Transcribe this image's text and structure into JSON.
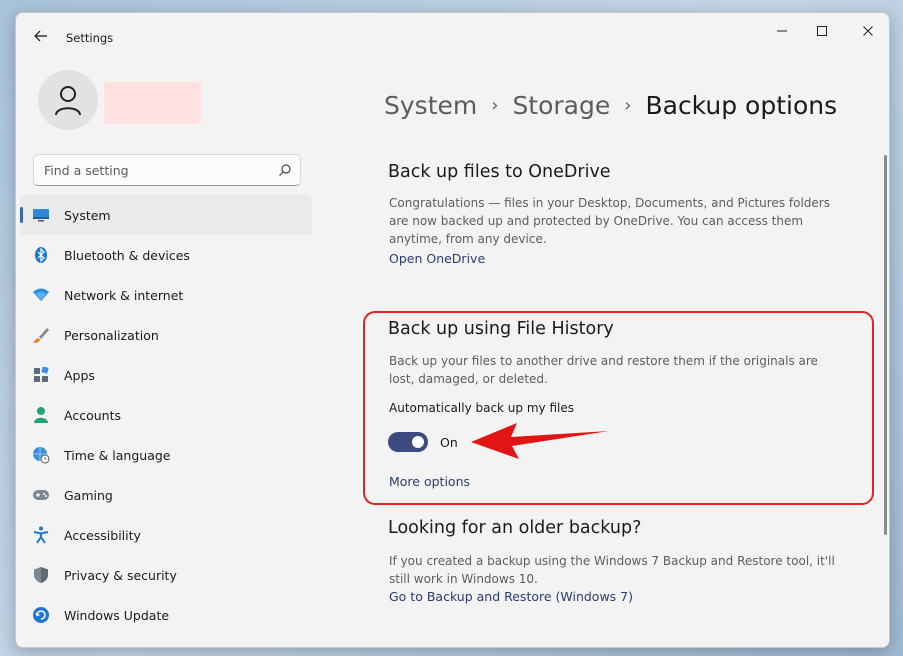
{
  "window": {
    "title": "Settings"
  },
  "search": {
    "placeholder": "Find a setting"
  },
  "nav": {
    "items": [
      {
        "label": "System",
        "icon": "monitor-icon"
      },
      {
        "label": "Bluetooth & devices",
        "icon": "bluetooth-icon"
      },
      {
        "label": "Network & internet",
        "icon": "wifi-icon"
      },
      {
        "label": "Personalization",
        "icon": "brush-icon"
      },
      {
        "label": "Apps",
        "icon": "apps-icon"
      },
      {
        "label": "Accounts",
        "icon": "person-icon"
      },
      {
        "label": "Time & language",
        "icon": "globe-clock-icon"
      },
      {
        "label": "Gaming",
        "icon": "gamepad-icon"
      },
      {
        "label": "Accessibility",
        "icon": "accessibility-icon"
      },
      {
        "label": "Privacy & security",
        "icon": "shield-icon"
      },
      {
        "label": "Windows Update",
        "icon": "update-icon"
      }
    ],
    "active": "System"
  },
  "breadcrumb": {
    "items": [
      "System",
      "Storage",
      "Backup options"
    ]
  },
  "onedrive": {
    "title": "Back up files to OneDrive",
    "description": "Congratulations — files in your Desktop, Documents, and Pictures folders are now backed up and protected by OneDrive. You can access them anytime, from any device.",
    "link": "Open OneDrive"
  },
  "file_history": {
    "title": "Back up using File History",
    "description": "Back up your files to another drive and restore them if the originals are lost, damaged, or deleted.",
    "auto_label": "Automatically back up my files",
    "toggle_state": "On",
    "more_link": "More options"
  },
  "older_backup": {
    "title": "Looking for an older backup?",
    "description": "If you created a backup using the Windows 7 Backup and Restore tool, it'll still work in Windows 10.",
    "link": "Go to Backup and Restore (Windows 7)"
  },
  "colors": {
    "accent": "#3d4a82",
    "highlight": "#e02424",
    "link": "#2a3d73"
  }
}
